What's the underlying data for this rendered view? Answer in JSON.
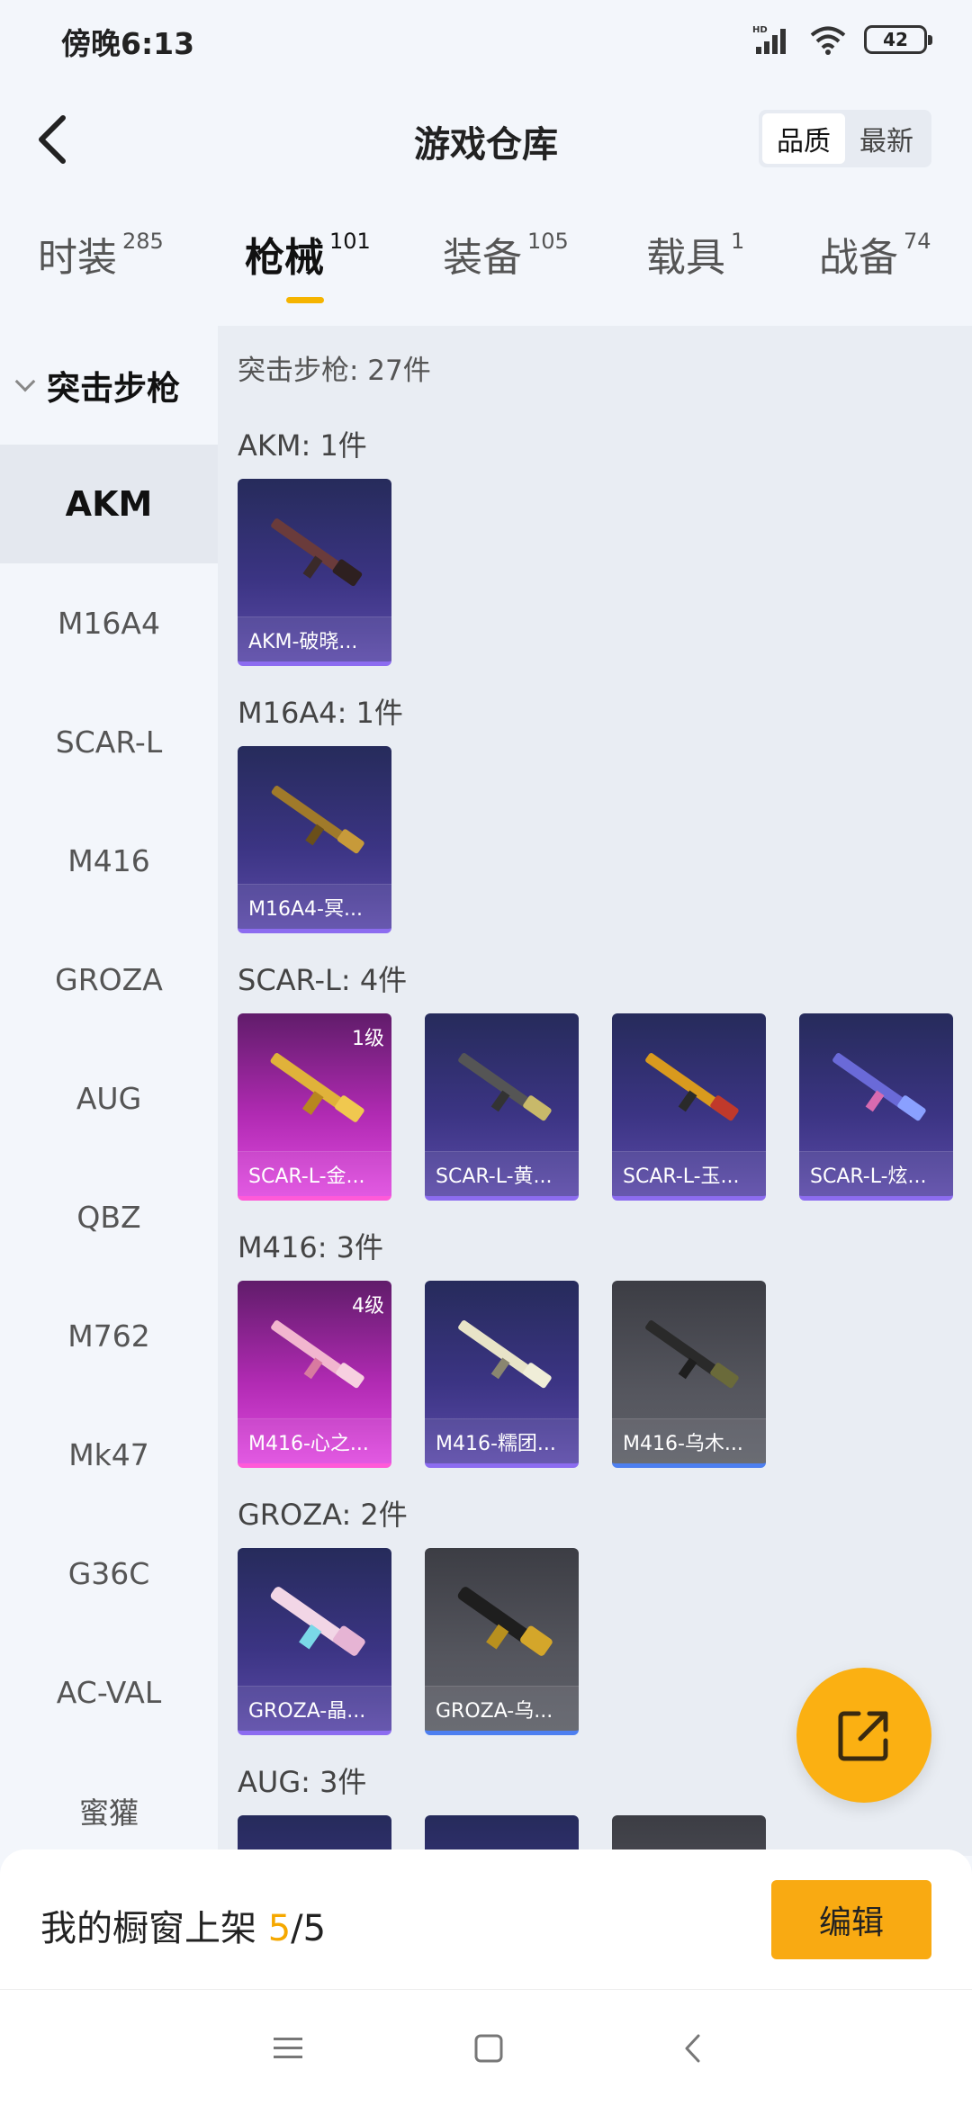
{
  "status": {
    "time": "傍晚6:13",
    "battery": "42"
  },
  "header": {
    "title": "游戏仓库",
    "sort_options": [
      "品质",
      "最新"
    ]
  },
  "tabs": [
    {
      "label": "时装",
      "count": "285"
    },
    {
      "label": "枪械",
      "count": "101"
    },
    {
      "label": "装备",
      "count": "105"
    },
    {
      "label": "载具",
      "count": "1"
    },
    {
      "label": "战备",
      "count": "74"
    }
  ],
  "sidebar": {
    "group": "突击步枪",
    "items": [
      "AKM",
      "M16A4",
      "SCAR-L",
      "M416",
      "GROZA",
      "AUG",
      "QBZ",
      "M762",
      "Mk47",
      "G36C",
      "AC-VAL",
      "蜜獾"
    ]
  },
  "main": {
    "total": "突击步枪: 27件",
    "sections": [
      {
        "title": "AKM: 1件",
        "cards": [
          {
            "name": "AKM-破晓...",
            "level": ""
          }
        ]
      },
      {
        "title": "M16A4: 1件",
        "cards": [
          {
            "name": "M16A4-冥...",
            "level": ""
          }
        ]
      },
      {
        "title": "SCAR-L: 4件",
        "cards": [
          {
            "name": "SCAR-L-金...",
            "level": "1级"
          },
          {
            "name": "SCAR-L-黄...",
            "level": ""
          },
          {
            "name": "SCAR-L-玉...",
            "level": ""
          },
          {
            "name": "SCAR-L-炫...",
            "level": ""
          }
        ]
      },
      {
        "title": "M416: 3件",
        "cards": [
          {
            "name": "M416-心之...",
            "level": "4级"
          },
          {
            "name": "M416-糯团...",
            "level": ""
          },
          {
            "name": "M416-乌木...",
            "level": ""
          }
        ]
      },
      {
        "title": "GROZA: 2件",
        "cards": [
          {
            "name": "GROZA-晶...",
            "level": ""
          },
          {
            "name": "GROZA-乌...",
            "level": ""
          }
        ]
      },
      {
        "title": "AUG: 3件",
        "cards": []
      }
    ]
  },
  "bottom": {
    "label": "我的橱窗上架",
    "current": "5",
    "sep": "/",
    "total": "5",
    "edit": "编辑"
  },
  "colors": {
    "accent": "#f9aa12",
    "tab_underline": "#f5b400",
    "purple_card": "#3b3483",
    "pink_card": "#b02ab2",
    "gray_card": "#55565e"
  },
  "icons": {
    "back": "chevron-left-icon",
    "share": "external-link-icon",
    "signal": "signal-icon",
    "wifi": "wifi-icon"
  }
}
